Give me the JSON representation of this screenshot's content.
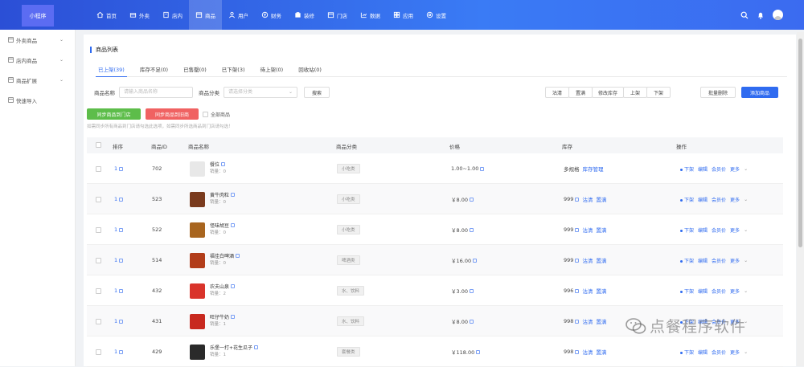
{
  "app": {
    "logo": "小程序"
  },
  "nav": [
    {
      "label": "首页",
      "icon": "home-icon"
    },
    {
      "label": "外卖",
      "icon": "takeout-icon"
    },
    {
      "label": "店内",
      "icon": "store-icon"
    },
    {
      "label": "商品",
      "icon": "goods-icon",
      "active": true
    },
    {
      "label": "用户",
      "icon": "user-icon"
    },
    {
      "label": "财务",
      "icon": "finance-icon"
    },
    {
      "label": "装修",
      "icon": "decorate-icon"
    },
    {
      "label": "门店",
      "icon": "shop-icon"
    },
    {
      "label": "数据",
      "icon": "data-icon"
    },
    {
      "label": "应用",
      "icon": "apps-icon"
    },
    {
      "label": "设置",
      "icon": "settings-icon"
    }
  ],
  "sidebar": [
    {
      "label": "外卖商品",
      "has_chevron": true
    },
    {
      "label": "店内商品",
      "has_chevron": true
    },
    {
      "label": "商品扩展",
      "has_chevron": true
    },
    {
      "label": "快速导入",
      "has_chevron": false
    }
  ],
  "page": {
    "title": "商品列表"
  },
  "tabs": [
    {
      "label": "已上架(39)",
      "active": true
    },
    {
      "label": "库存不足(0)"
    },
    {
      "label": "已售罄(0)"
    },
    {
      "label": "已下架(3)"
    },
    {
      "label": "待上架(0)"
    },
    {
      "label": "回收站(0)"
    }
  ],
  "filter": {
    "name_label": "商品名称",
    "name_placeholder": "请输入商品名称",
    "category_label": "商品分类",
    "category_placeholder": "请选择分类",
    "search_button": "搜索",
    "actions": [
      "沽清",
      "置满",
      "修改库存",
      "上架",
      "下架"
    ],
    "batch_delete": "批量删除",
    "add_product": "添加商品",
    "sync_to_store": "同步商品到门店",
    "sync_to_merchant": "同步商品到旧商",
    "all_products_label": "全部商品",
    "hint": "如需同步所有商品到门店请勾选此选项，如需同步所选商品到门店请勾选！"
  },
  "table": {
    "headers": [
      "排序",
      "商品ID",
      "商品名称",
      "商品分类",
      "价格",
      "库存",
      "操作"
    ],
    "rows": [
      {
        "sort": "1",
        "id": "702",
        "name": "餐位",
        "sales": "销量：0",
        "category": "小吃类",
        "price": "1.00~1.00",
        "stock": "多规格",
        "stock_link1": "库存管理",
        "stock_link2": "",
        "thumb": "#e8e8e8"
      },
      {
        "sort": "1",
        "id": "523",
        "name": "黄牛肉粒",
        "sales": "销量：0",
        "category": "小吃类",
        "price": "￥8.00",
        "stock": "999",
        "stock_link1": "沽清",
        "stock_link2": "置满",
        "thumb": "#7a3b1e"
      },
      {
        "sort": "1",
        "id": "522",
        "name": "怪味胡豆",
        "sales": "销量：0",
        "category": "小吃类",
        "price": "￥8.00",
        "stock": "999",
        "stock_link1": "沽清",
        "stock_link2": "置满",
        "thumb": "#a8651f"
      },
      {
        "sort": "1",
        "id": "514",
        "name": "福佳白啤酒",
        "sales": "销量：0",
        "category": "啤酒类",
        "price": "￥16.00",
        "stock": "999",
        "stock_link1": "沽清",
        "stock_link2": "置满",
        "thumb": "#b23d1a"
      },
      {
        "sort": "1",
        "id": "432",
        "name": "农夫山泉",
        "sales": "销量：2",
        "category": "水、饮料",
        "price": "￥3.00",
        "stock": "996",
        "stock_link1": "沽清",
        "stock_link2": "置满",
        "thumb": "#d9342b"
      },
      {
        "sort": "1",
        "id": "431",
        "name": "旺仔牛奶",
        "sales": "销量：1",
        "category": "水、饮料",
        "price": "￥8.00",
        "stock": "998",
        "stock_link1": "沽清",
        "stock_link2": "置满",
        "thumb": "#c8291f"
      },
      {
        "sort": "1",
        "id": "429",
        "name": "乐堡一打+花生瓜子",
        "sales": "销量：1",
        "category": "套餐类",
        "price": "￥118.00",
        "stock": "998",
        "stock_link1": "沽清",
        "stock_link2": "置满",
        "thumb": "#2a2a2a"
      }
    ],
    "ops": [
      "下架",
      "编辑",
      "会员价",
      "更多"
    ]
  },
  "watermark": {
    "text": "点餐程序软件"
  }
}
